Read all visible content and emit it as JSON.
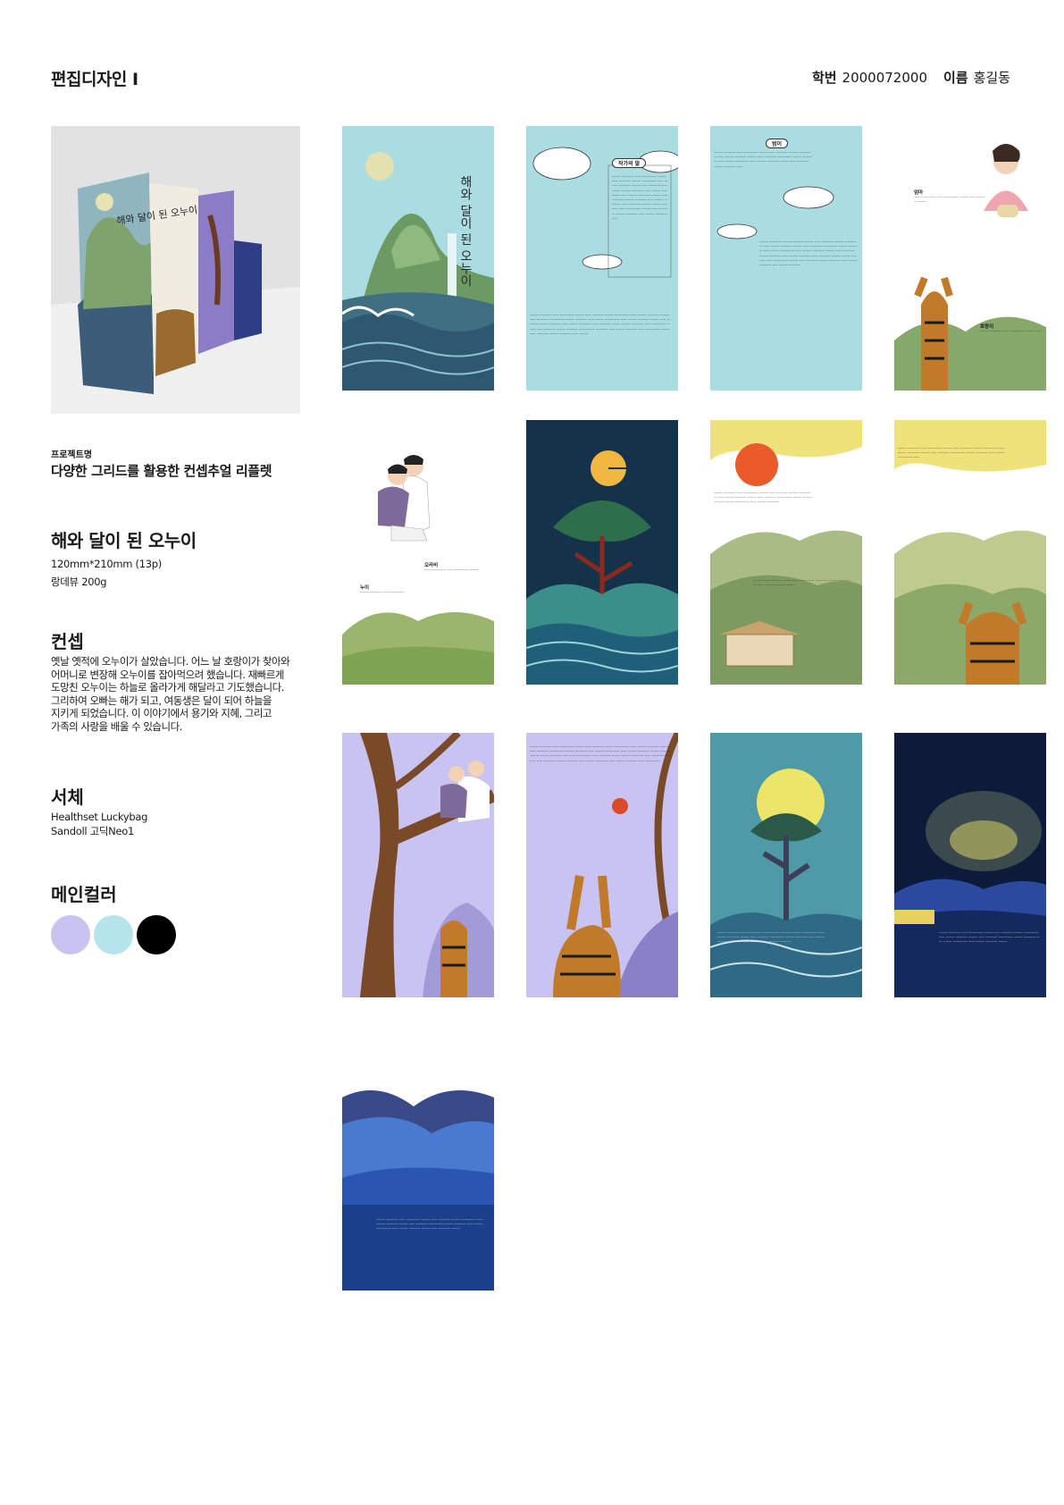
{
  "header": {
    "course_title": "편집디자인 I",
    "student_id_label": "학번",
    "student_id": "2000072000",
    "name_label": "이름",
    "name": "홍길동"
  },
  "photo": {
    "cover_title": "해와 달이 된 오누이"
  },
  "project": {
    "label": "프로젝트명",
    "title": "다양한 그리드를 활용한 컨셉추얼 리플렛"
  },
  "book": {
    "title": "해와 달이 된 오누이",
    "size": "120mm*210mm (13p)",
    "paper": "랑데뷰 200g"
  },
  "concept": {
    "heading": "컨셉",
    "body": "옛날 옛적에 오누이가 살았습니다. 어느 날 호랑이가 찾아와\n어머니로 변장해 오누이를 잡아먹으려 했습니다. 재빠르게\n도망친 오누이는 하늘로 올라가게 해달라고 기도했습니다.\n그리하여 오빠는 해가 되고, 여동생은 달이 되어 하늘을\n지키게 되었습니다. 이 이야기에서 용기와 지혜, 그리고\n가족의 사랑을 배울 수 있습니다."
  },
  "typeface": {
    "heading": "서체",
    "fonts": [
      "Healthset Luckybag",
      "Sandoll 고딕Neo1"
    ]
  },
  "main_color": {
    "heading": "메인컬러",
    "colors": [
      "#c9c3f1",
      "#b5e5ea",
      "#000000"
    ]
  },
  "pages": {
    "p1_title": "해와 달이 된 오누이",
    "p2_tag": "작가의 말",
    "p3_tag": "범이",
    "p4_name": "엄마",
    "p4_name2": "호랑이",
    "p5_name": "오라비",
    "p5_name2": "누이"
  }
}
